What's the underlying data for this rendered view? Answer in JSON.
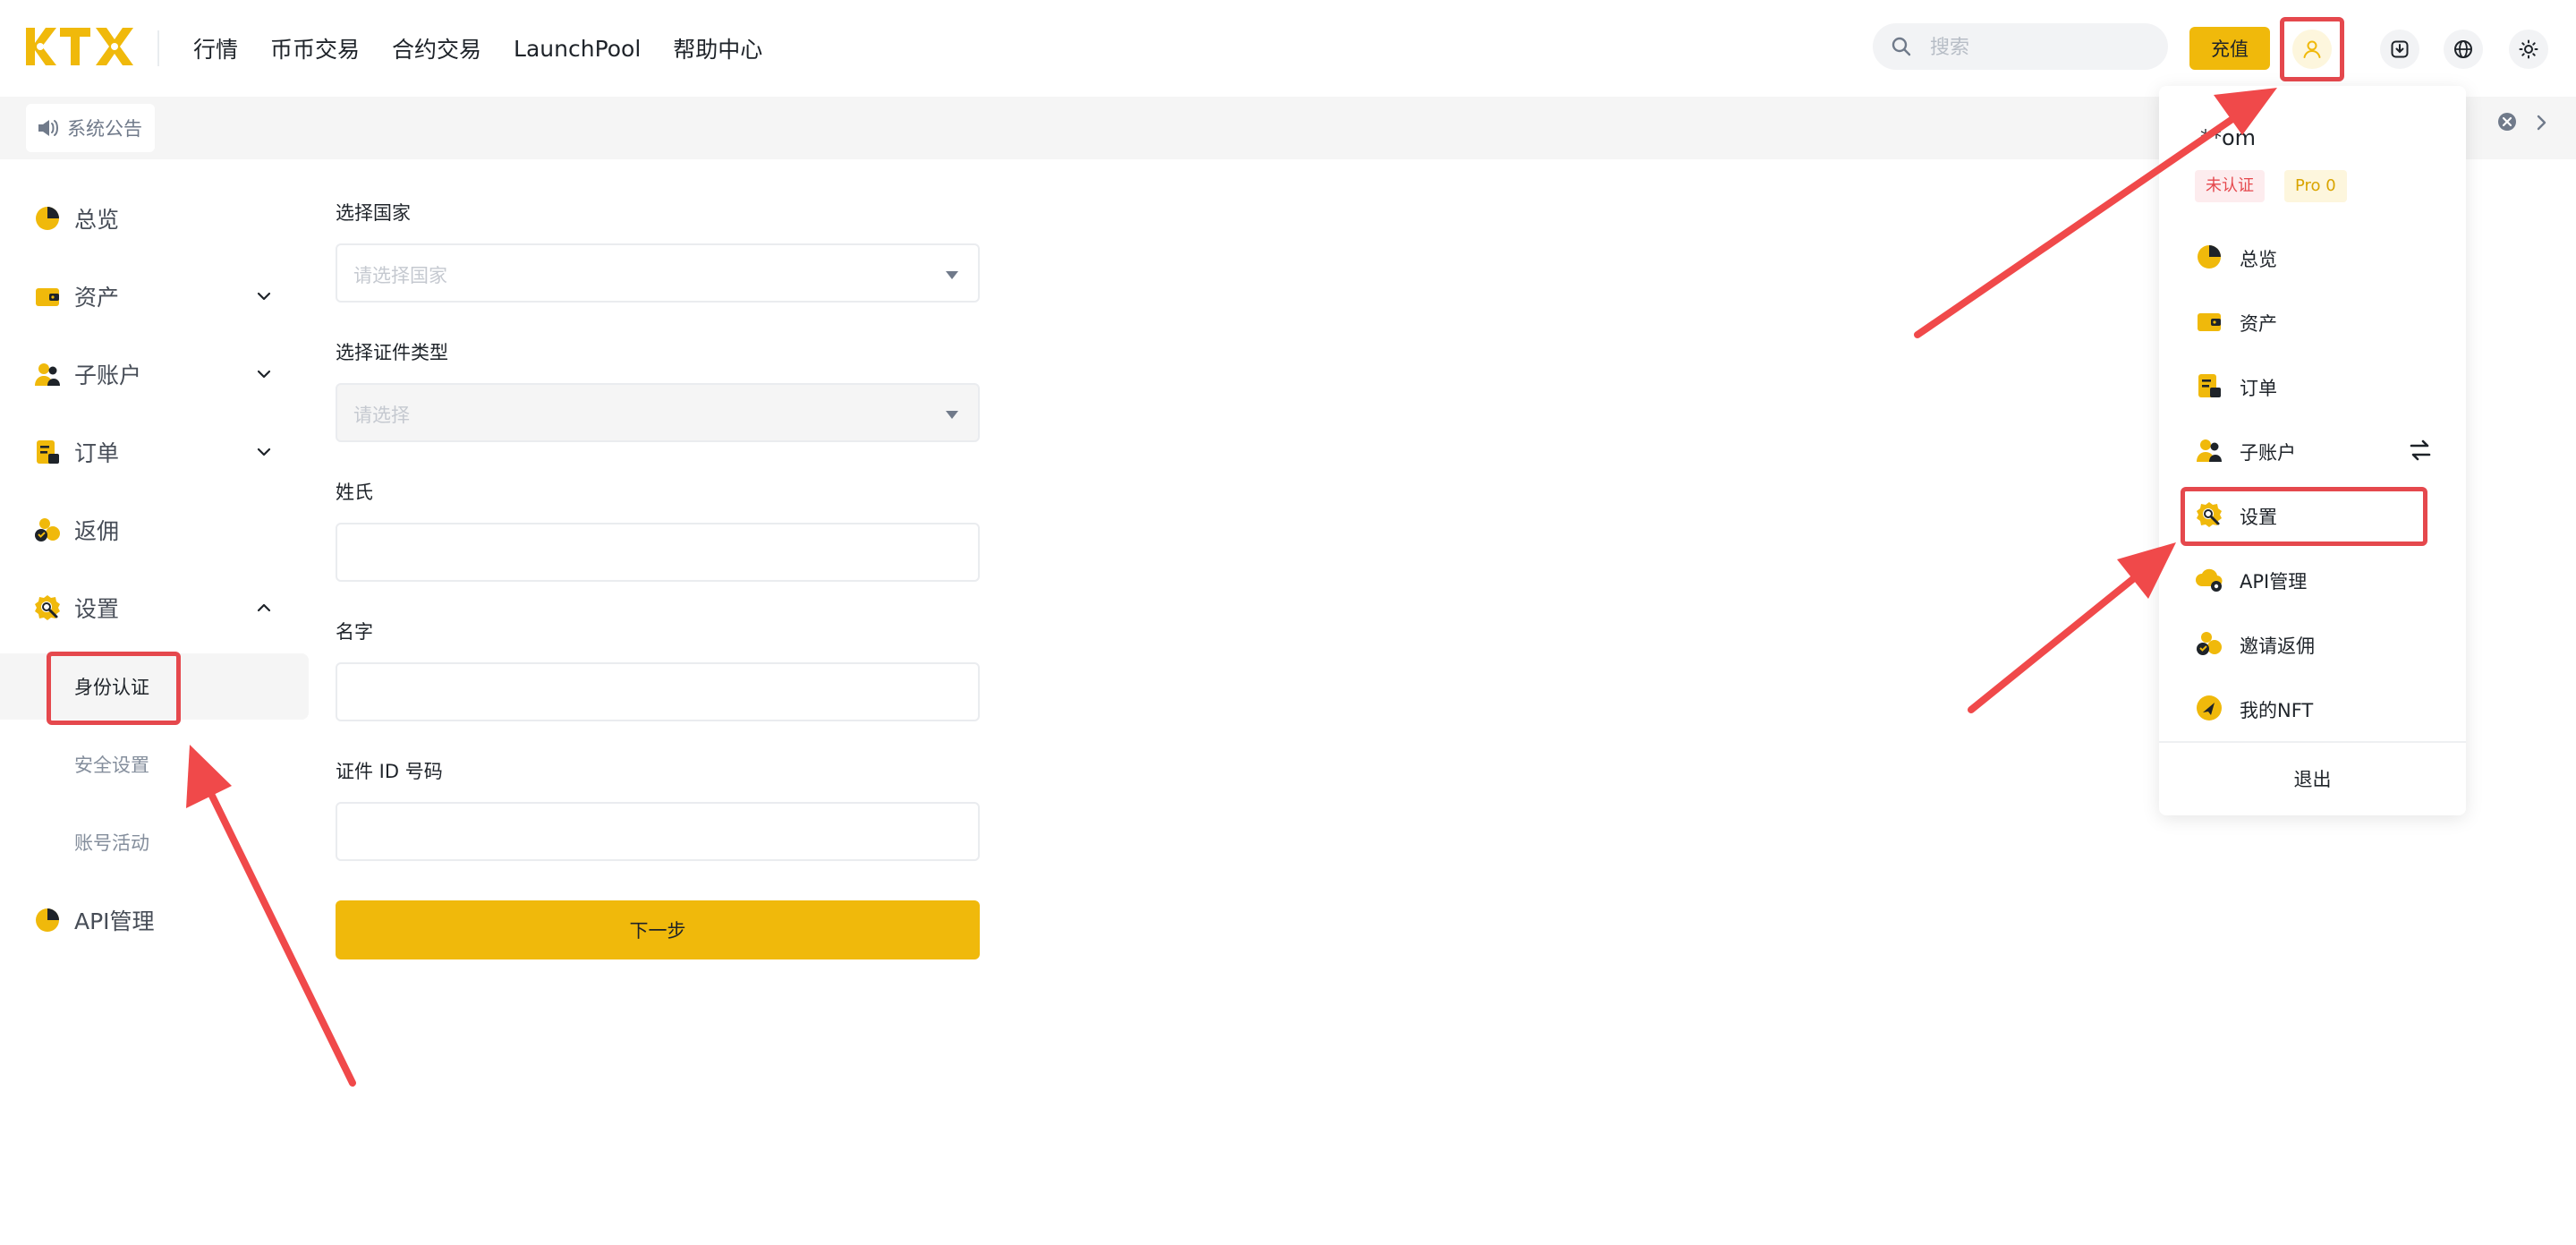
{
  "header": {
    "nav": [
      "行情",
      "币币交易",
      "合约交易",
      "LaunchPool",
      "帮助中心"
    ],
    "search_placeholder": "搜索",
    "recharge_label": "充值"
  },
  "announcement": {
    "label": "系统公告"
  },
  "sidebar": {
    "items": [
      {
        "label": "总览",
        "icon": "pie-chart-icon",
        "chevron": "none"
      },
      {
        "label": "资产",
        "icon": "wallet-icon",
        "chevron": "down"
      },
      {
        "label": "子账户",
        "icon": "sub-account-icon",
        "chevron": "down"
      },
      {
        "label": "订单",
        "icon": "order-icon",
        "chevron": "down"
      },
      {
        "label": "返佣",
        "icon": "rebate-icon",
        "chevron": "none"
      },
      {
        "label": "设置",
        "icon": "settings-icon",
        "chevron": "up"
      }
    ],
    "settings_sub": [
      "身份认证",
      "安全设置",
      "账号活动"
    ],
    "active_sub": "身份认证",
    "api": {
      "label": "API管理",
      "icon": "api-icon"
    }
  },
  "form": {
    "country_label": "选择国家",
    "country_placeholder": "请选择国家",
    "doc_type_label": "选择证件类型",
    "doc_type_placeholder": "请选择",
    "surname_label": "姓氏",
    "given_name_label": "名字",
    "id_label": "证件 ID 号码",
    "next_label": "下一步"
  },
  "dropdown": {
    "user": "**om",
    "badge_unverified": "未认证",
    "badge_pro": "Pro 0",
    "items": [
      {
        "label": "总览",
        "icon": "pie-chart-icon"
      },
      {
        "label": "资产",
        "icon": "wallet-icon"
      },
      {
        "label": "订单",
        "icon": "order-icon"
      },
      {
        "label": "子账户",
        "icon": "sub-account-icon",
        "swap": true
      },
      {
        "label": "设置",
        "icon": "settings-icon"
      },
      {
        "label": "API管理",
        "icon": "api-icon"
      },
      {
        "label": "邀请返佣",
        "icon": "rebate-icon"
      },
      {
        "label": "我的NFT",
        "icon": "nft-icon"
      }
    ],
    "logout": "退出"
  },
  "colors": {
    "brand": "#f0b90b",
    "highlight": "#e5484d",
    "text_primary": "#1e2329",
    "text_secondary": "#848e9c"
  }
}
